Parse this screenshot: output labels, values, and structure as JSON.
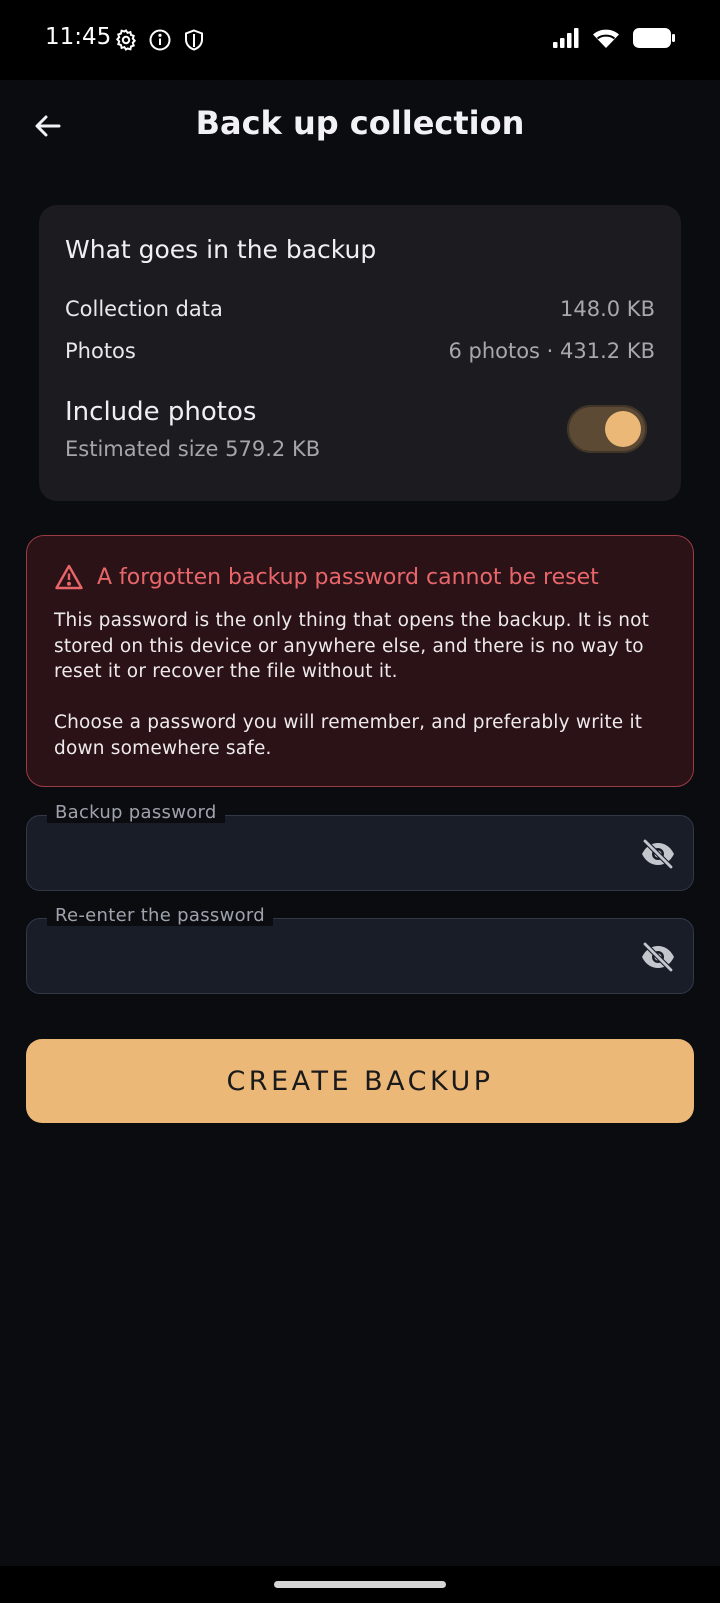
{
  "status_bar": {
    "time": "11:45",
    "left_icons": [
      "gear-icon",
      "info-icon",
      "shield-icon"
    ],
    "right_icons": [
      "signal-icon",
      "wifi-icon",
      "battery-icon"
    ]
  },
  "app_bar": {
    "back_icon": "arrow-left-icon",
    "title": "Back up collection"
  },
  "backup_card": {
    "heading": "What goes in the backup",
    "rows": [
      {
        "label": "Collection data",
        "value": "148.0 KB"
      },
      {
        "label": "Photos",
        "value": "6 photos · 431.2 KB"
      }
    ],
    "include_photos": {
      "title": "Include photos",
      "subtitle": "Estimated size 579.2 KB",
      "enabled": true
    }
  },
  "warning": {
    "icon": "warning-triangle-icon",
    "title": "A forgotten backup password cannot be reset",
    "paragraphs": [
      "This password is the only thing that opens the backup. It is not stored on this device or anywhere else, and there is no way to reset it or recover the file without it.",
      "Choose a password you will remember, and preferably write it down somewhere safe."
    ]
  },
  "fields": {
    "password": {
      "label": "Backup password",
      "value": "",
      "icon": "eye-off-icon"
    },
    "confirm": {
      "label": "Re-enter the password",
      "value": "",
      "icon": "eye-off-icon"
    }
  },
  "actions": {
    "create_label": "CREATE BACKUP"
  },
  "colors": {
    "background": "#0b0c10",
    "card": "#1c1b20",
    "accent": "#ebb877",
    "warning_text": "#e8666a",
    "warning_bg": "#2a1217",
    "warning_border": "#9a3c42"
  }
}
